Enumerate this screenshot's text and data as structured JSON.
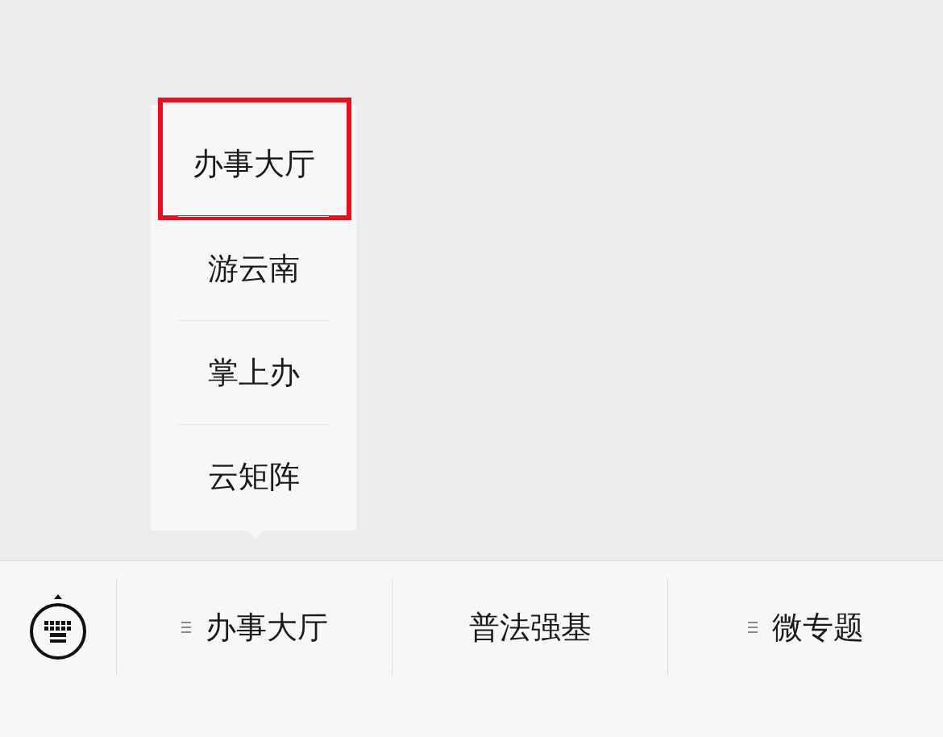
{
  "popup_menu": {
    "items": [
      {
        "label": "办事大厅",
        "highlighted": true
      },
      {
        "label": "游云南",
        "highlighted": false
      },
      {
        "label": "掌上办",
        "highlighted": false
      },
      {
        "label": "云矩阵",
        "highlighted": false
      }
    ]
  },
  "menu_bar": {
    "tabs": [
      {
        "label": "办事大厅",
        "has_submenu": true
      },
      {
        "label": "普法强基",
        "has_submenu": false
      },
      {
        "label": "微专题",
        "has_submenu": true
      }
    ]
  }
}
